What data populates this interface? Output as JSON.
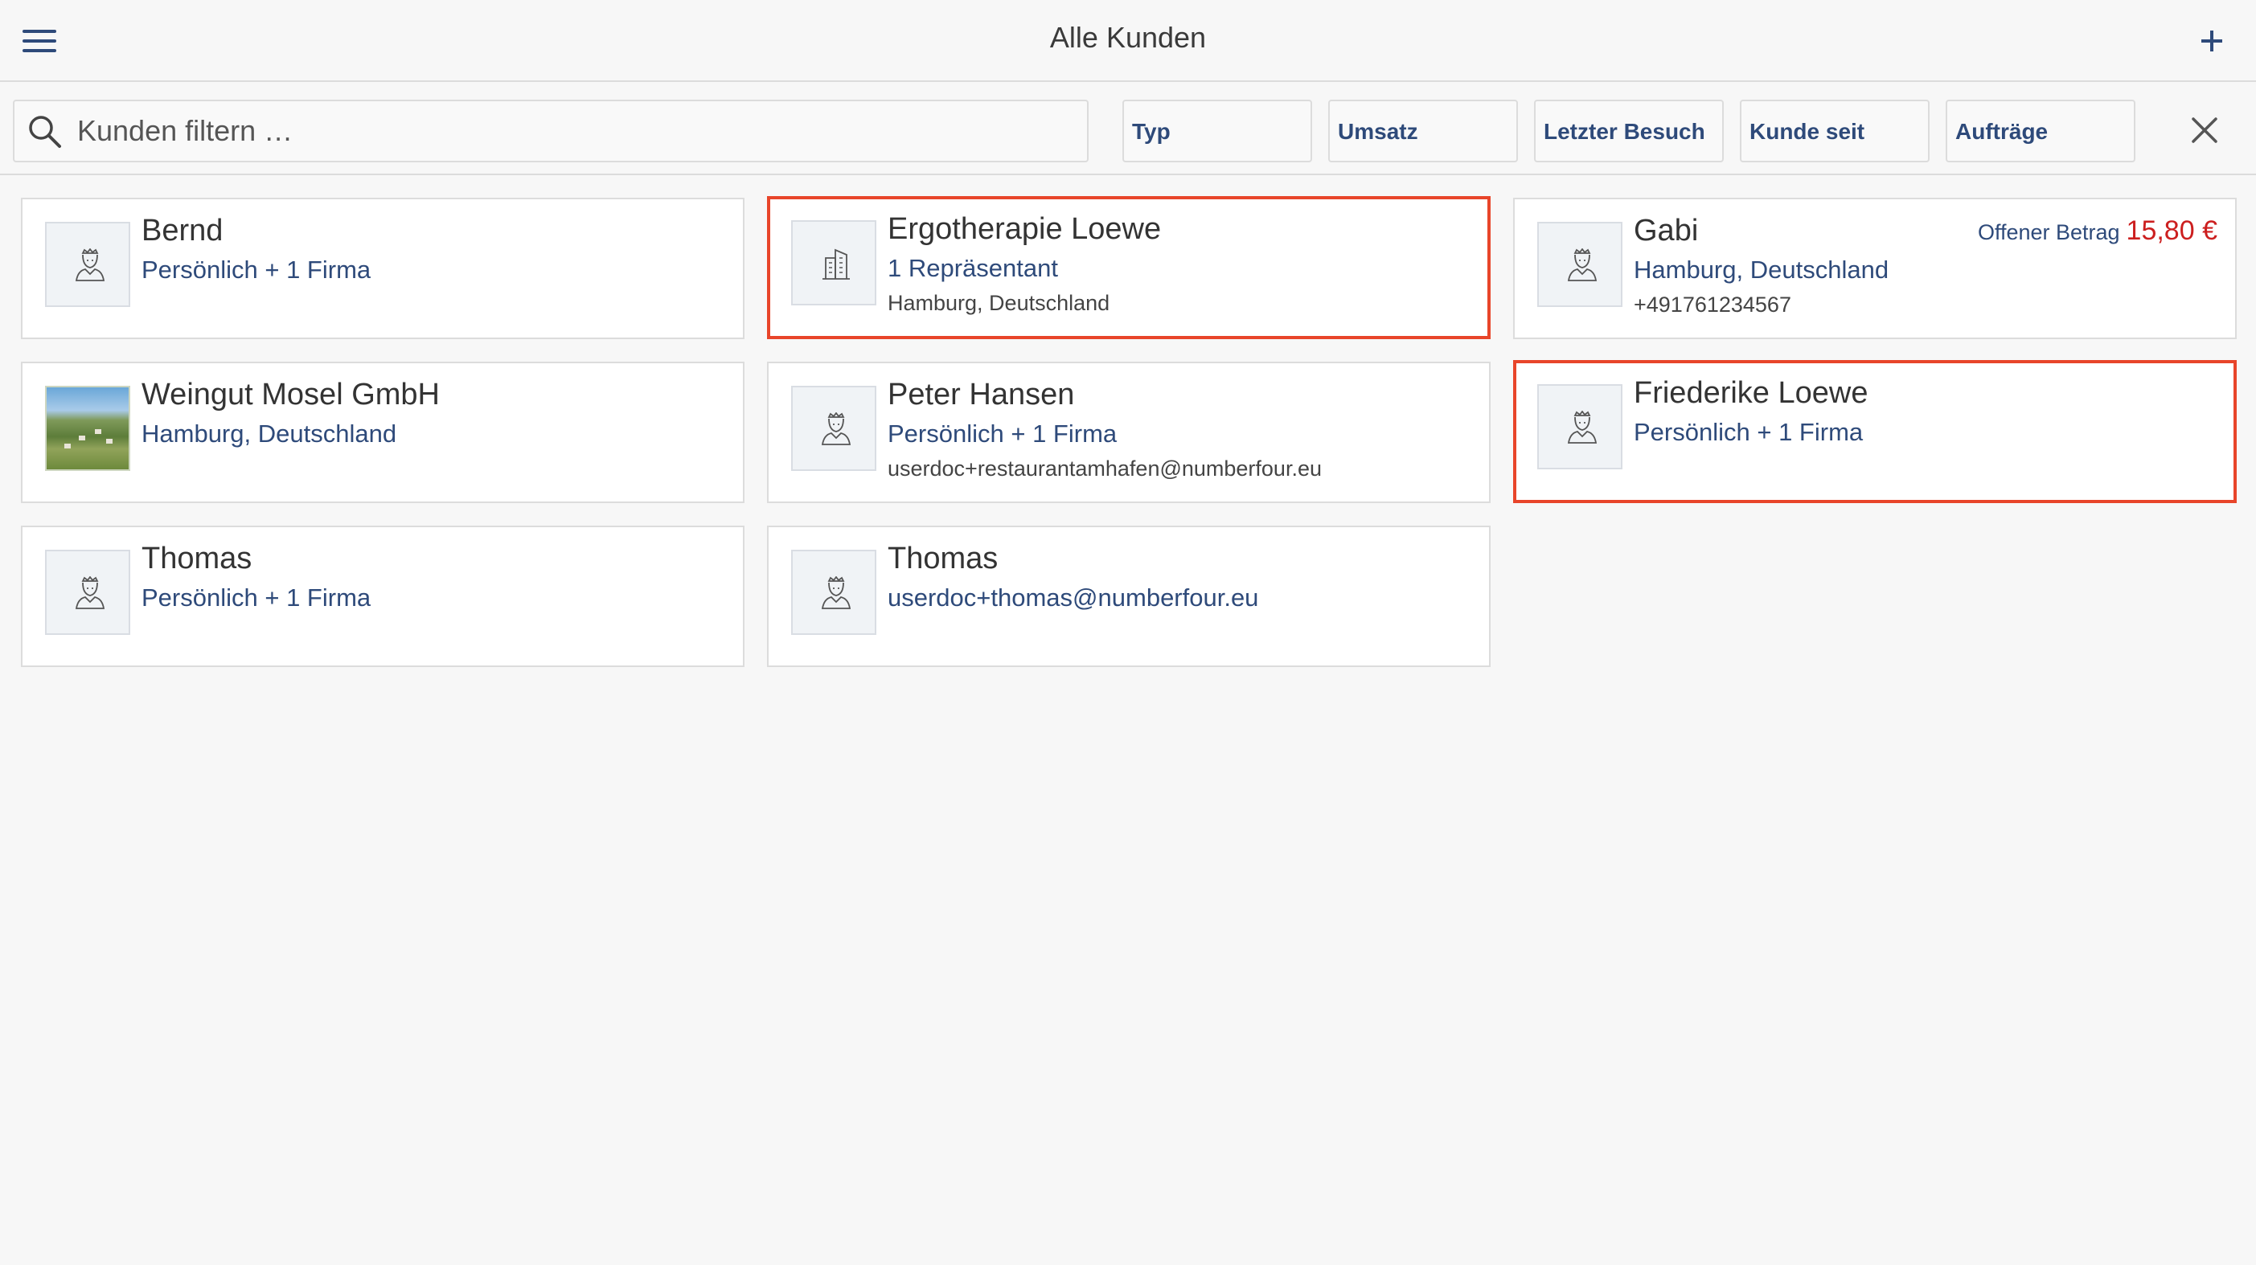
{
  "header": {
    "title": "Alle Kunden"
  },
  "filter": {
    "search_placeholder": "Kunden filtern …",
    "search_value": "",
    "chips": [
      "Typ",
      "Umsatz",
      "Letzter Besuch",
      "Kunde seit",
      "Aufträge"
    ]
  },
  "customers": [
    {
      "name": "Bernd",
      "line2": "Persönlich + 1 Firma",
      "line3": "",
      "avatar": "person-icon",
      "highlighted": false
    },
    {
      "name": "Ergotherapie Loewe",
      "line2": "1 Repräsentant",
      "line3": "Hamburg, Deutschland",
      "avatar": "building-icon",
      "highlighted": true
    },
    {
      "name": "Gabi",
      "line2": "Hamburg, Deutschland",
      "line3": "+491761234567",
      "avatar": "person-icon",
      "highlighted": false,
      "open_amount_label": "Offener Betrag",
      "open_amount_value": "15,80 €"
    },
    {
      "name": "Weingut Mosel GmbH",
      "line2": "Hamburg, Deutschland",
      "line3": "",
      "avatar": "photo",
      "highlighted": false
    },
    {
      "name": "Peter Hansen",
      "line2": "Persönlich + 1 Firma",
      "line3": "userdoc+restaurantamhafen@numberfour.eu",
      "avatar": "person-icon",
      "highlighted": false
    },
    {
      "name": "Friederike Loewe",
      "line2": "Persönlich + 1 Firma",
      "line3": "",
      "avatar": "person-icon",
      "highlighted": true
    },
    {
      "name": "Thomas",
      "line2": "Persönlich + 1 Firma",
      "line3": "",
      "avatar": "person-icon",
      "highlighted": false
    },
    {
      "name": "Thomas",
      "line2": "userdoc+thomas@numberfour.eu",
      "line3": "",
      "avatar": "person-icon",
      "highlighted": false
    }
  ],
  "colors": {
    "accent": "#2e4a7a",
    "highlight_border": "#e8452a",
    "amount_red": "#cc1f1f",
    "background": "#f7f7f7"
  }
}
